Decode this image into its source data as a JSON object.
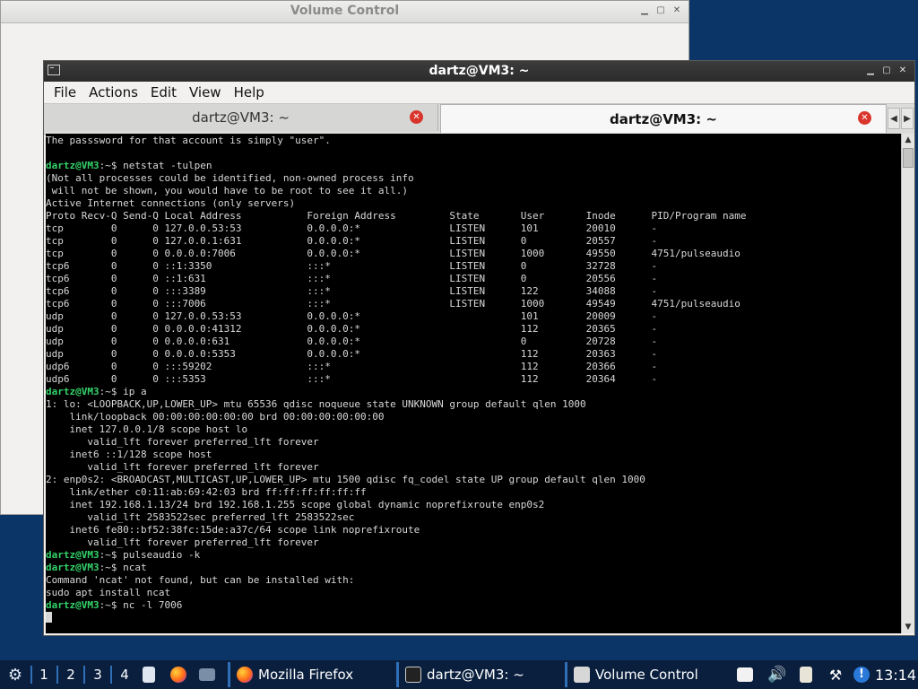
{
  "volume_window": {
    "title": "Volume Control"
  },
  "terminal_window": {
    "title": "dartz@VM3: ~",
    "menu": [
      "File",
      "Actions",
      "Edit",
      "View",
      "Help"
    ],
    "tabs": [
      {
        "label": "dartz@VM3: ~",
        "active": false
      },
      {
        "label": "dartz@VM3: ~",
        "active": true
      }
    ],
    "prompt": "dartz@VM3",
    "lines": [
      {
        "t": "The passsword for that account is simply \"user\"."
      },
      {
        "t": ""
      },
      {
        "p": ":~$ netstat -tulpen"
      },
      {
        "t": "(Not all processes could be identified, non-owned process info"
      },
      {
        "t": " will not be shown, you would have to be root to see it all.)"
      },
      {
        "t": "Active Internet connections (only servers)"
      },
      {
        "t": "Proto Recv-Q Send-Q Local Address           Foreign Address         State       User       Inode      PID/Program name"
      },
      {
        "t": "tcp        0      0 127.0.0.53:53           0.0.0.0:*               LISTEN      101        20010      -"
      },
      {
        "t": "tcp        0      0 127.0.0.1:631           0.0.0.0:*               LISTEN      0          20557      -"
      },
      {
        "t": "tcp        0      0 0.0.0.0:7006            0.0.0.0:*               LISTEN      1000       49550      4751/pulseaudio"
      },
      {
        "t": "tcp6       0      0 ::1:3350                :::*                    LISTEN      0          32728      -"
      },
      {
        "t": "tcp6       0      0 ::1:631                 :::*                    LISTEN      0          20556      -"
      },
      {
        "t": "tcp6       0      0 :::3389                 :::*                    LISTEN      122        34088      -"
      },
      {
        "t": "tcp6       0      0 :::7006                 :::*                    LISTEN      1000       49549      4751/pulseaudio"
      },
      {
        "t": "udp        0      0 127.0.0.53:53           0.0.0.0:*                           101        20009      -"
      },
      {
        "t": "udp        0      0 0.0.0.0:41312           0.0.0.0:*                           112        20365      -"
      },
      {
        "t": "udp        0      0 0.0.0.0:631             0.0.0.0:*                           0          20728      -"
      },
      {
        "t": "udp        0      0 0.0.0.0:5353            0.0.0.0:*                           112        20363      -"
      },
      {
        "t": "udp6       0      0 :::59202                :::*                                112        20366      -"
      },
      {
        "t": "udp6       0      0 :::5353                 :::*                                112        20364      -"
      },
      {
        "p": ":~$ ip a"
      },
      {
        "t": "1: lo: <LOOPBACK,UP,LOWER_UP> mtu 65536 qdisc noqueue state UNKNOWN group default qlen 1000"
      },
      {
        "t": "    link/loopback 00:00:00:00:00:00 brd 00:00:00:00:00:00"
      },
      {
        "t": "    inet 127.0.0.1/8 scope host lo"
      },
      {
        "t": "       valid_lft forever preferred_lft forever"
      },
      {
        "t": "    inet6 ::1/128 scope host"
      },
      {
        "t": "       valid_lft forever preferred_lft forever"
      },
      {
        "t": "2: enp0s2: <BROADCAST,MULTICAST,UP,LOWER_UP> mtu 1500 qdisc fq_codel state UP group default qlen 1000"
      },
      {
        "t": "    link/ether c0:11:ab:69:42:03 brd ff:ff:ff:ff:ff:ff"
      },
      {
        "t": "    inet 192.168.1.13/24 brd 192.168.1.255 scope global dynamic noprefixroute enp0s2"
      },
      {
        "t": "       valid_lft 2583522sec preferred_lft 2583522sec"
      },
      {
        "t": "    inet6 fe80::bf52:38fc:15de:a37c/64 scope link noprefixroute"
      },
      {
        "t": "       valid_lft forever preferred_lft forever"
      },
      {
        "p": ":~$ pulseaudio -k"
      },
      {
        "p": ":~$ ncat"
      },
      {
        "t": "Command 'ncat' not found, but can be installed with:"
      },
      {
        "t": "sudo apt install ncat"
      },
      {
        "p": ":~$ nc -l 7006"
      }
    ],
    "colors": {
      "prompt": "#33d36a",
      "text": "#d8d8d8",
      "background": "#000000",
      "tab_close": "#d9352c"
    }
  },
  "taskbar": {
    "workspaces": [
      "1",
      "2",
      "3",
      "4"
    ],
    "tasks": [
      {
        "label": "Mozilla Firefox",
        "icon": "firefox-icon"
      },
      {
        "label": "dartz@VM3: ~",
        "icon": "terminal-icon"
      },
      {
        "label": "Volume Control",
        "icon": "volume-control-icon"
      }
    ],
    "clock": "13:14",
    "colors": {
      "background": "#0a1f3e",
      "accent": "#2f6fb8",
      "desktop": "#0b3566"
    }
  }
}
